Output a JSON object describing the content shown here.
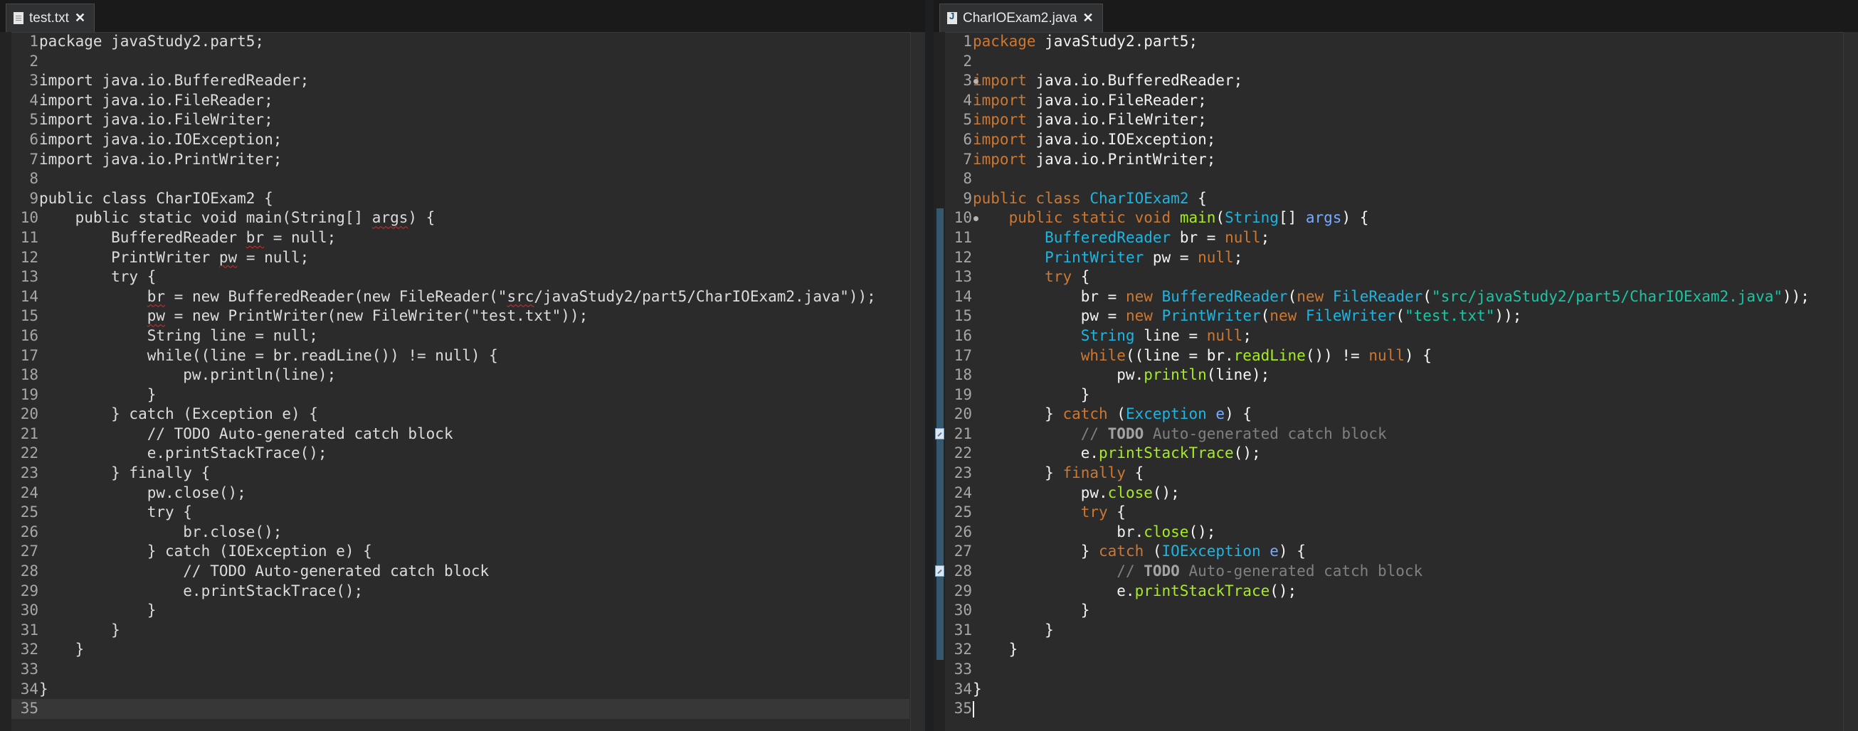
{
  "left": {
    "tab_label": "test.txt",
    "lines": [
      "package javaStudy2.part5;",
      "",
      "import java.io.BufferedReader;",
      "import java.io.FileReader;",
      "import java.io.FileWriter;",
      "import java.io.IOException;",
      "import java.io.PrintWriter;",
      "",
      "public class CharIOExam2 {",
      "    public static void main(String[] args) {",
      "        BufferedReader br = null;",
      "        PrintWriter pw = null;",
      "        try {",
      "            br = new BufferedReader(new FileReader(\"src/javaStudy2/part5/CharIOExam2.java\"));",
      "            pw = new PrintWriter(new FileWriter(\"test.txt\"));",
      "            String line = null;",
      "            while((line = br.readLine()) != null) {",
      "                pw.println(line);",
      "            }",
      "        } catch (Exception e) {",
      "            // TODO Auto-generated catch block",
      "            e.printStackTrace();",
      "        } finally {",
      "            pw.close();",
      "            try {",
      "                br.close();",
      "            } catch (IOException e) {",
      "                // TODO Auto-generated catch block",
      "                e.printStackTrace();",
      "            }",
      "        }",
      "    }",
      "",
      "}",
      ""
    ]
  },
  "right": {
    "tab_label": "CharIOExam2.java",
    "lines": [
      [
        [
          "k",
          "package"
        ],
        [
          "n",
          " javaStudy2.part5;"
        ]
      ],
      [],
      [
        [
          "k",
          "import"
        ],
        [
          "n",
          " java.io.BufferedReader;"
        ]
      ],
      [
        [
          "k",
          "import"
        ],
        [
          "n",
          " java.io.FileReader;"
        ]
      ],
      [
        [
          "k",
          "import"
        ],
        [
          "n",
          " java.io.FileWriter;"
        ]
      ],
      [
        [
          "k",
          "import"
        ],
        [
          "n",
          " java.io.IOException;"
        ]
      ],
      [
        [
          "k",
          "import"
        ],
        [
          "n",
          " java.io.PrintWriter;"
        ]
      ],
      [],
      [
        [
          "k",
          "public"
        ],
        [
          "n",
          " "
        ],
        [
          "k",
          "class"
        ],
        [
          "n",
          " "
        ],
        [
          "t",
          "CharIOExam2"
        ],
        [
          "n",
          " {"
        ]
      ],
      [
        [
          "n",
          "    "
        ],
        [
          "k",
          "public"
        ],
        [
          "n",
          " "
        ],
        [
          "k",
          "static"
        ],
        [
          "n",
          " "
        ],
        [
          "k",
          "void"
        ],
        [
          "n",
          " "
        ],
        [
          "m",
          "main"
        ],
        [
          "p",
          "("
        ],
        [
          "t",
          "String"
        ],
        [
          "p",
          "[] "
        ],
        [
          "v",
          "args"
        ],
        [
          "p",
          ") {"
        ]
      ],
      [
        [
          "n",
          "        "
        ],
        [
          "t",
          "BufferedReader"
        ],
        [
          "n",
          " br "
        ],
        [
          "p",
          "="
        ],
        [
          "n",
          " "
        ],
        [
          "k",
          "null"
        ],
        [
          "p",
          ";"
        ]
      ],
      [
        [
          "n",
          "        "
        ],
        [
          "t",
          "PrintWriter"
        ],
        [
          "n",
          " pw "
        ],
        [
          "p",
          "="
        ],
        [
          "n",
          " "
        ],
        [
          "k",
          "null"
        ],
        [
          "p",
          ";"
        ]
      ],
      [
        [
          "n",
          "        "
        ],
        [
          "k",
          "try"
        ],
        [
          "n",
          " {"
        ]
      ],
      [
        [
          "n",
          "            br "
        ],
        [
          "p",
          "="
        ],
        [
          "n",
          " "
        ],
        [
          "k",
          "new"
        ],
        [
          "n",
          " "
        ],
        [
          "t",
          "BufferedReader"
        ],
        [
          "p",
          "("
        ],
        [
          "k",
          "new"
        ],
        [
          "n",
          " "
        ],
        [
          "t",
          "FileReader"
        ],
        [
          "p",
          "("
        ],
        [
          "s",
          "\"src/javaStudy2/part5/CharIOExam2.java\""
        ],
        [
          "p",
          "));"
        ]
      ],
      [
        [
          "n",
          "            pw "
        ],
        [
          "p",
          "="
        ],
        [
          "n",
          " "
        ],
        [
          "k",
          "new"
        ],
        [
          "n",
          " "
        ],
        [
          "t",
          "PrintWriter"
        ],
        [
          "p",
          "("
        ],
        [
          "k",
          "new"
        ],
        [
          "n",
          " "
        ],
        [
          "t",
          "FileWriter"
        ],
        [
          "p",
          "("
        ],
        [
          "s",
          "\"test.txt\""
        ],
        [
          "p",
          "));"
        ]
      ],
      [
        [
          "n",
          "            "
        ],
        [
          "t",
          "String"
        ],
        [
          "n",
          " line "
        ],
        [
          "p",
          "="
        ],
        [
          "n",
          " "
        ],
        [
          "k",
          "null"
        ],
        [
          "p",
          ";"
        ]
      ],
      [
        [
          "n",
          "            "
        ],
        [
          "k",
          "while"
        ],
        [
          "p",
          "((line = br."
        ],
        [
          "m",
          "readLine"
        ],
        [
          "p",
          "()) != "
        ],
        [
          "k",
          "null"
        ],
        [
          "p",
          ") {"
        ]
      ],
      [
        [
          "n",
          "                pw."
        ],
        [
          "m",
          "println"
        ],
        [
          "p",
          "(line);"
        ]
      ],
      [
        [
          "n",
          "            }"
        ]
      ],
      [
        [
          "n",
          "        } "
        ],
        [
          "k",
          "catch"
        ],
        [
          "n",
          " ("
        ],
        [
          "t",
          "Exception"
        ],
        [
          "n",
          " "
        ],
        [
          "v",
          "e"
        ],
        [
          "n",
          ") {"
        ]
      ],
      [
        [
          "n",
          "            "
        ],
        [
          "c",
          "// "
        ],
        [
          "td",
          "TODO"
        ],
        [
          "c",
          " Auto-generated catch block"
        ]
      ],
      [
        [
          "n",
          "            e."
        ],
        [
          "m",
          "printStackTrace"
        ],
        [
          "p",
          "();"
        ]
      ],
      [
        [
          "n",
          "        } "
        ],
        [
          "k",
          "finally"
        ],
        [
          "n",
          " {"
        ]
      ],
      [
        [
          "n",
          "            pw."
        ],
        [
          "m",
          "close"
        ],
        [
          "p",
          "();"
        ]
      ],
      [
        [
          "n",
          "            "
        ],
        [
          "k",
          "try"
        ],
        [
          "n",
          " {"
        ]
      ],
      [
        [
          "n",
          "                br."
        ],
        [
          "m",
          "close"
        ],
        [
          "p",
          "();"
        ]
      ],
      [
        [
          "n",
          "            } "
        ],
        [
          "k",
          "catch"
        ],
        [
          "n",
          " ("
        ],
        [
          "t",
          "IOException"
        ],
        [
          "n",
          " "
        ],
        [
          "v",
          "e"
        ],
        [
          "n",
          ") {"
        ]
      ],
      [
        [
          "n",
          "                "
        ],
        [
          "c",
          "// "
        ],
        [
          "td",
          "TODO"
        ],
        [
          "c",
          " Auto-generated catch block"
        ]
      ],
      [
        [
          "n",
          "                e."
        ],
        [
          "m",
          "printStackTrace"
        ],
        [
          "p",
          "();"
        ]
      ],
      [
        [
          "n",
          "            }"
        ]
      ],
      [
        [
          "n",
          "        }"
        ]
      ],
      [
        [
          "n",
          "    }"
        ]
      ],
      [],
      [
        [
          "n",
          "}"
        ]
      ],
      []
    ]
  },
  "colors": {
    "keyword": "#cc7832",
    "type": "#1eb5e0",
    "method": "#a7ec21",
    "param": "#79abff",
    "string": "#17c6a3",
    "comment": "#808080",
    "background": "#2b2b2b"
  }
}
